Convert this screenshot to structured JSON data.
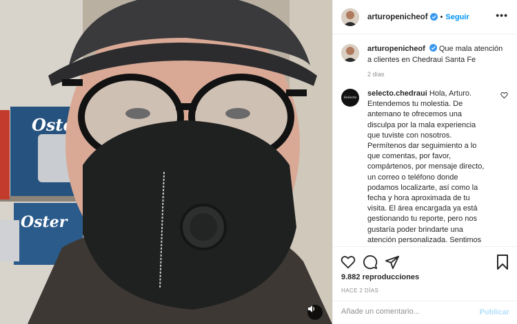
{
  "post": {
    "author": "arturopenicheof",
    "follow_label": "Seguir",
    "dot": "•",
    "more": "•••",
    "caption": "Que mala atención a clientes en Chedraui Santa Fe",
    "caption_time": "2 días"
  },
  "comment": {
    "author": "selecto.chedraui",
    "avatar_text": "Selecto",
    "text": "Hola, Arturo. Entendemos tu molestia. De antemano te ofrecemos una disculpa por la mala experiencia que tuviste con nosotros. Permítenos dar seguimiento a lo que comentas, por favor, compártenos, por mensaje directo, un correo o teléfono donde podamos localizarte, así como la fecha y hora aproximada de tu visita. El área encargada ya está gestionando tu reporte, pero nos gustaría poder brindarte una atención personalizada. Sentimos"
  },
  "stats": {
    "views": "9.882 reproducciones",
    "posted": "HACE 2 DÍAS"
  },
  "add_comment": {
    "placeholder": "Añade un comentario...",
    "publish": "Publicar"
  },
  "video": {
    "brand_top": "Oster",
    "brand_bottom": "Oster"
  },
  "colors": {
    "link": "#0095f6",
    "publish_disabled": "#b2dffc",
    "verified": "#3897f0"
  },
  "icons": [
    "heart-icon",
    "comment-icon",
    "share-icon",
    "bookmark-icon",
    "volume-icon",
    "verified-icon",
    "more-icon"
  ]
}
